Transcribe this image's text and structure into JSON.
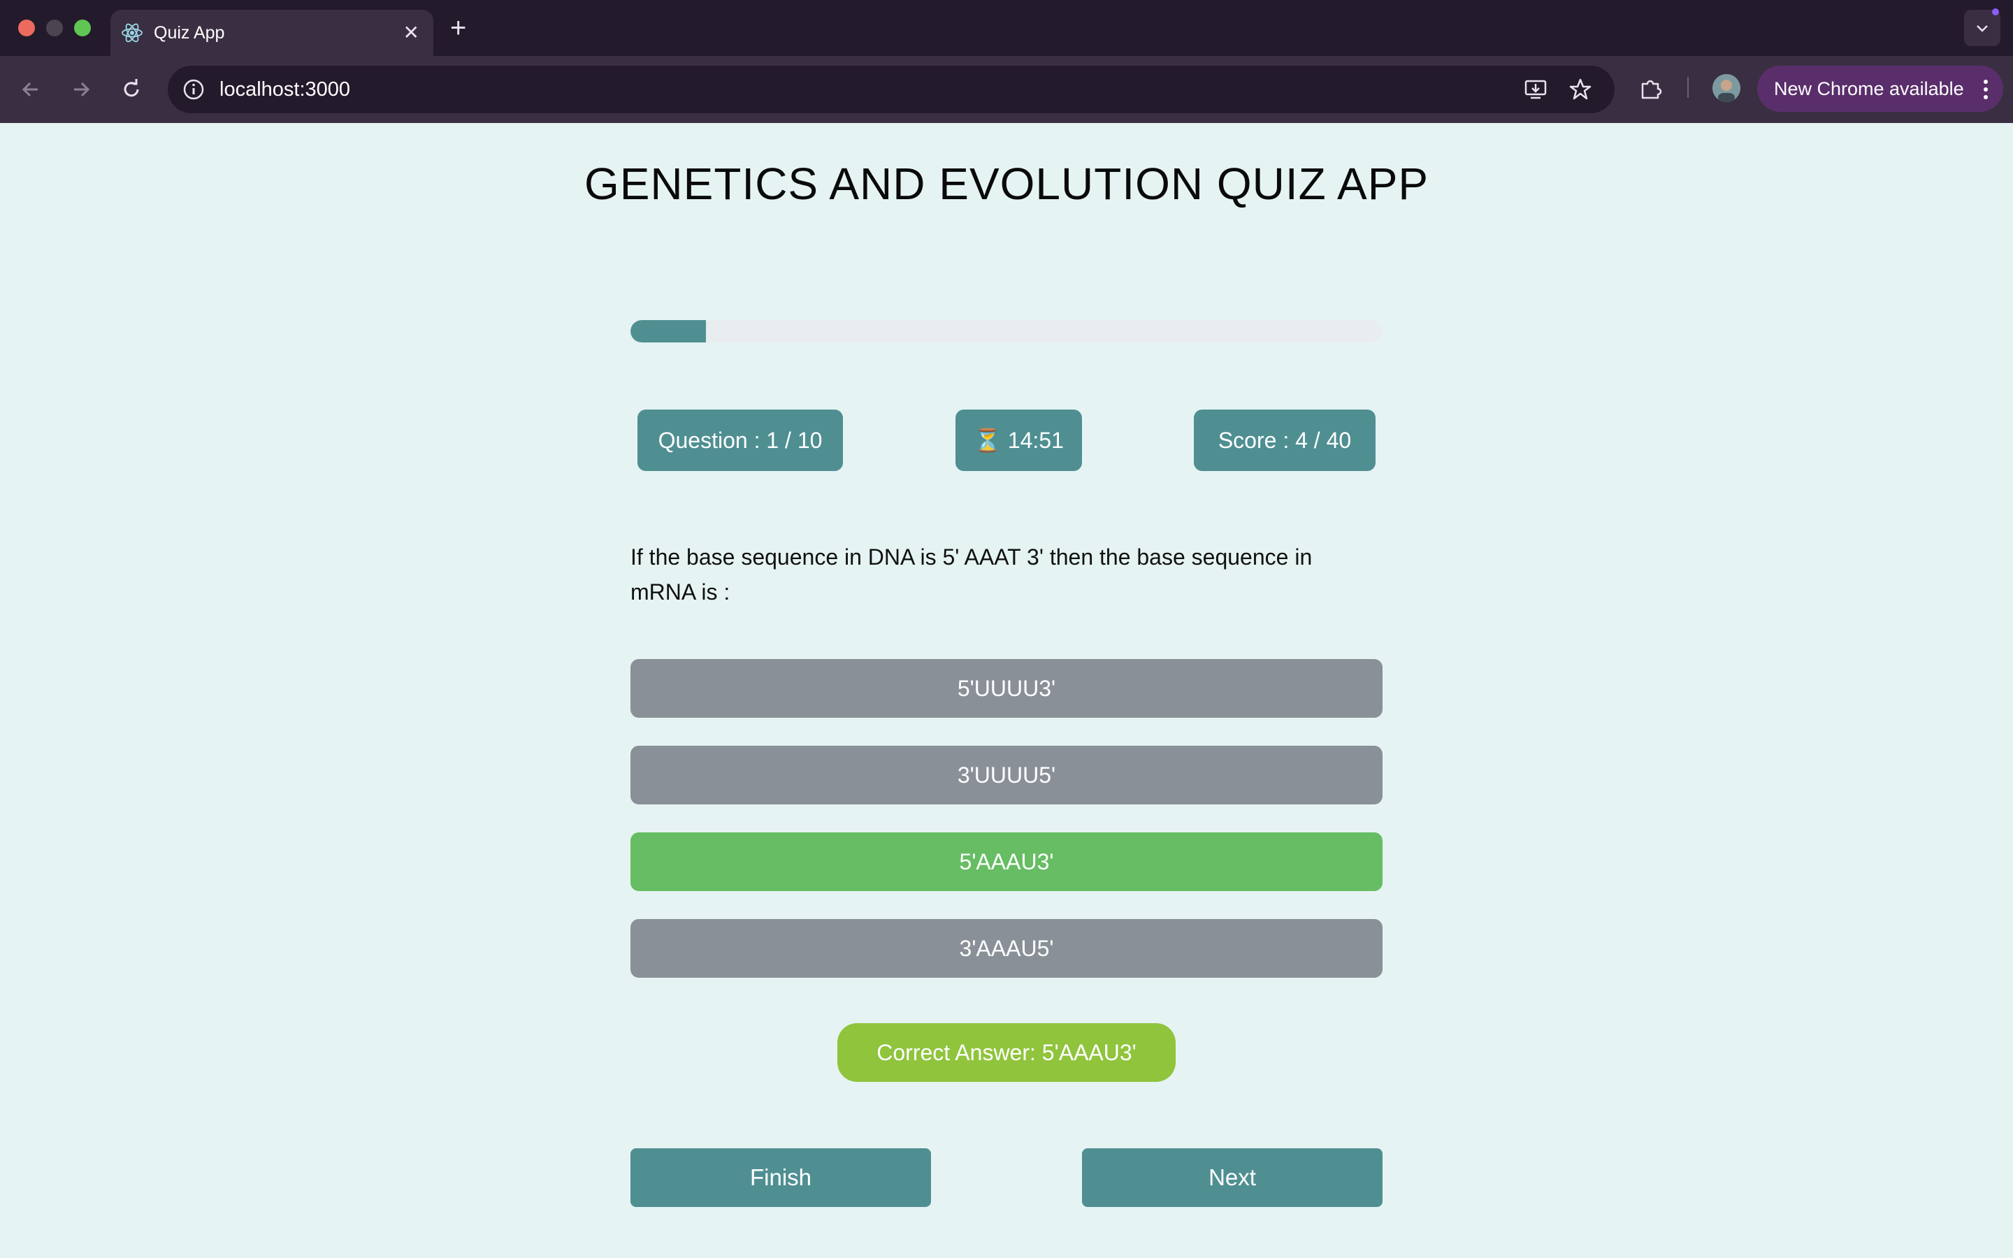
{
  "browser": {
    "tab_title": "Quiz App",
    "tab_close": "✕",
    "new_tab": "+",
    "url": "localhost:3000",
    "update_label": "New Chrome available"
  },
  "app": {
    "title": "GENETICS AND EVOLUTION QUIZ APP"
  },
  "progress": {
    "fraction": 0.1
  },
  "stats": {
    "question": "Question : 1 / 10",
    "timer": "⏳ 14:51",
    "score": "Score : 4 / 40"
  },
  "question": {
    "text": "If the base sequence in DNA is 5' AAAT 3' then the base sequence in mRNA is :"
  },
  "options": [
    {
      "label": "5'UUUU3'",
      "color": "#8a9097"
    },
    {
      "label": "3'UUUU5'",
      "color": "#8a9097"
    },
    {
      "label": "5'AAAU3'",
      "color": "#66bd63"
    },
    {
      "label": "3'AAAU5'",
      "color": "#8a9097"
    }
  ],
  "feedback": {
    "correct_answer": "Correct Answer: 5'AAAU3'"
  },
  "actions": {
    "finish": "Finish",
    "next": "Next"
  },
  "colors": {
    "accent": "#4f8f92",
    "correct": "#66bd63",
    "neutral": "#8a9097",
    "feedback": "#8fc43c",
    "background": "#e6f3f3"
  }
}
